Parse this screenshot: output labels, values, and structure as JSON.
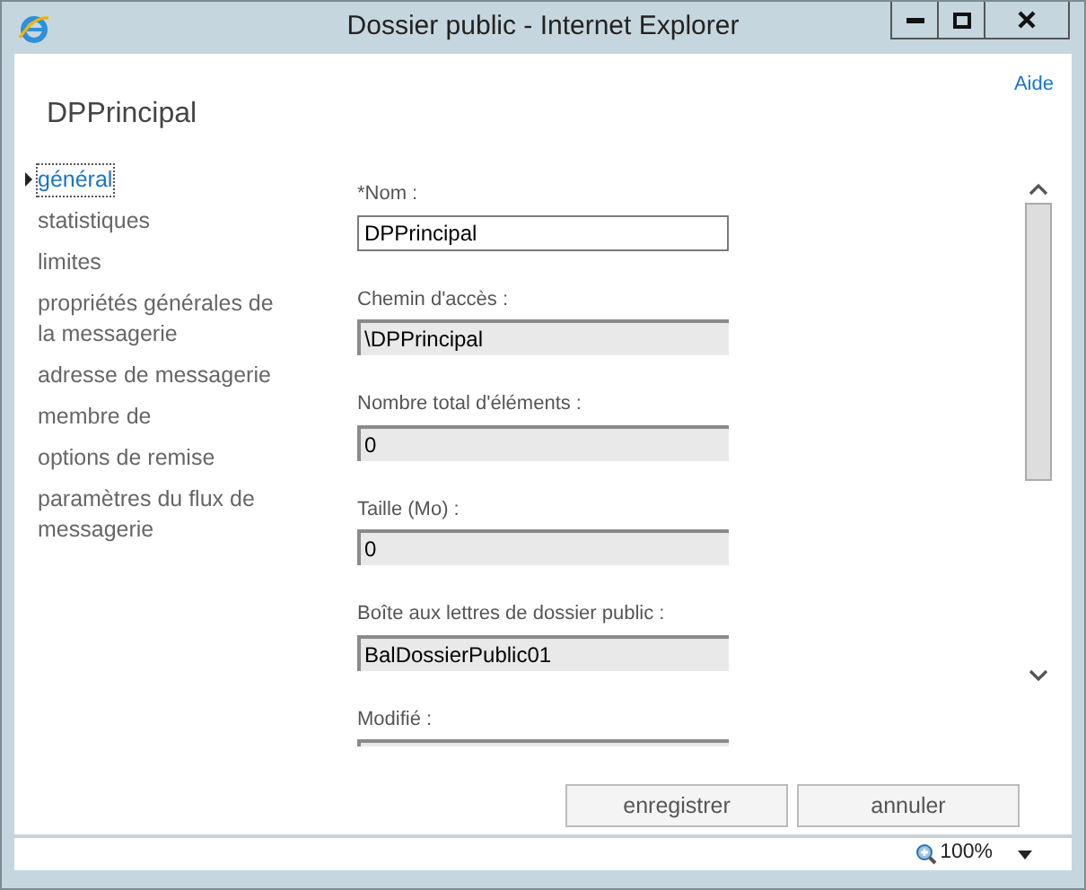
{
  "window": {
    "title": "Dossier public - Internet Explorer"
  },
  "help_link": "Aide",
  "heading": "DPPrincipal",
  "nav": [
    {
      "label": "général",
      "selected": true
    },
    {
      "label": "statistiques",
      "selected": false
    },
    {
      "label": "limites",
      "selected": false
    },
    {
      "label": "propriétés générales de la messagerie",
      "selected": false
    },
    {
      "label": "adresse de messagerie",
      "selected": false
    },
    {
      "label": "membre de",
      "selected": false
    },
    {
      "label": "options de remise",
      "selected": false
    },
    {
      "label": "paramètres du flux de messagerie",
      "selected": false
    }
  ],
  "fields": [
    {
      "label": "*Nom :",
      "value": "DPPrincipal",
      "readonly": false
    },
    {
      "label": "Chemin d'accès :",
      "value": "\\DPPrincipal",
      "readonly": true
    },
    {
      "label": "Nombre total d'éléments :",
      "value": "0",
      "readonly": true
    },
    {
      "label": "Taille (Mo) :",
      "value": "0",
      "readonly": true
    },
    {
      "label": "Boîte aux lettres de dossier public :",
      "value": "BalDossierPublic01",
      "readonly": true
    },
    {
      "label": "Modifié :",
      "readonly": true
    }
  ],
  "buttons": [
    "enregistrer",
    "annuler"
  ],
  "status_bar": {
    "zoom": "100%"
  }
}
